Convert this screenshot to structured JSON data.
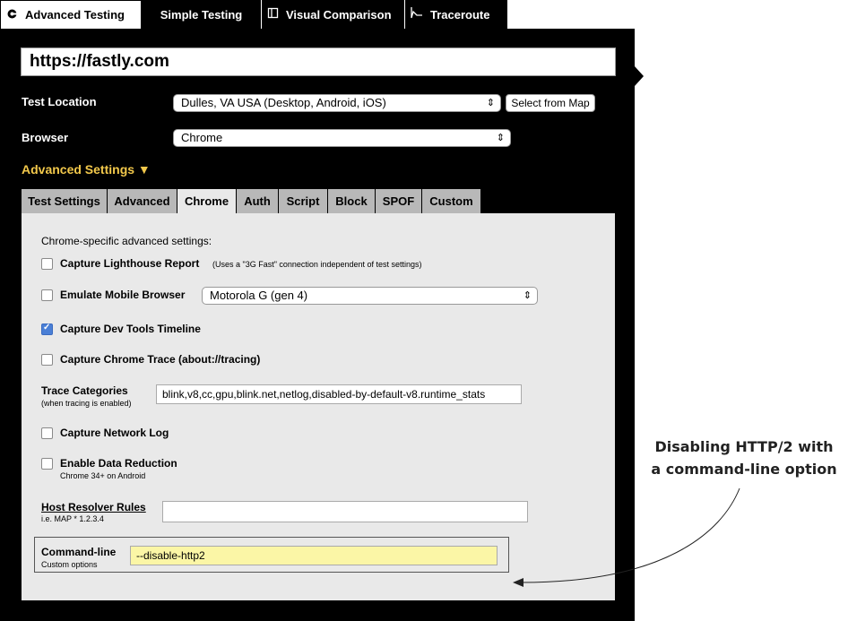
{
  "top_tabs": [
    {
      "label": "Advanced Testing",
      "icon": "gear-icon"
    },
    {
      "label": "Simple Testing"
    },
    {
      "label": "Visual Comparison",
      "icon": "document-icon"
    },
    {
      "label": "Traceroute",
      "icon": "trace-icon"
    }
  ],
  "url": "https://fastly.com",
  "test_location": {
    "label": "Test Location",
    "value": "Dulles, VA USA (Desktop, Android, iOS)",
    "map_button": "Select from Map"
  },
  "browser": {
    "label": "Browser",
    "value": "Chrome"
  },
  "advanced_settings": "Advanced Settings ▼",
  "sub_tabs": [
    "Test Settings",
    "Advanced",
    "Chrome",
    "Auth",
    "Script",
    "Block",
    "SPOF",
    "Custom"
  ],
  "chrome": {
    "heading": "Chrome-specific advanced settings:",
    "lighthouse_label": "Capture Lighthouse Report",
    "lighthouse_note": "(Uses a \"3G Fast\" connection independent of test settings)",
    "emulate_label": "Emulate Mobile Browser",
    "emulate_device": "Motorola G (gen 4)",
    "devtools_label": "Capture Dev Tools Timeline",
    "chrome_trace_label": "Capture Chrome Trace (about://tracing)",
    "trace_categories_label": "Trace Categories",
    "trace_categories_note": "(when tracing is enabled)",
    "trace_categories_value": "blink,v8,cc,gpu,blink.net,netlog,disabled-by-default-v8.runtime_stats",
    "network_log_label": "Capture Network Log",
    "data_reduction_label": "Enable Data Reduction",
    "data_reduction_note": "Chrome 34+ on Android",
    "host_resolver_label": "Host Resolver Rules",
    "host_resolver_note": "i.e. MAP * 1.2.3.4",
    "cmdline_label": "Command-line",
    "cmdline_note": "Custom options",
    "cmdline_value": "--disable-http2"
  },
  "annotation": {
    "line1": "Disabling HTTP/2 with",
    "line2": "a command-line option"
  }
}
